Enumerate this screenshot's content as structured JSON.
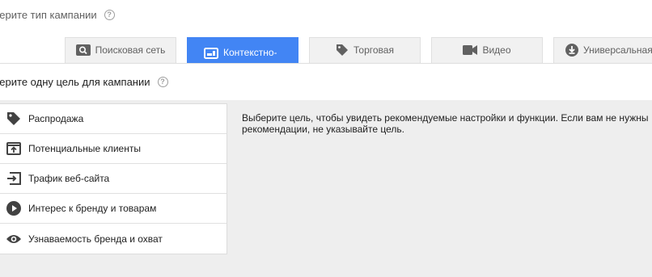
{
  "header": {
    "campaign_type_question": "берите тип кампании"
  },
  "tabs": [
    {
      "label": "Поисковая сеть",
      "icon": "search-icon"
    },
    {
      "label": "Контекстно-медийная",
      "icon": "display-icon"
    },
    {
      "label": "Торговая",
      "icon": "tag-icon"
    },
    {
      "label": "Видео",
      "icon": "video-icon"
    },
    {
      "label": "Универсальная",
      "icon": "download-icon"
    }
  ],
  "goal_section": {
    "question": "берите одну цель для кампании"
  },
  "goals": [
    {
      "label": "Распродажа",
      "icon": "tag-icon"
    },
    {
      "label": "Потенциальные клиенты",
      "icon": "upload-box-icon"
    },
    {
      "label": "Трафик веб-сайта",
      "icon": "enter-arrow-icon"
    },
    {
      "label": "Интерес к бренду и товарам",
      "icon": "play-circle-icon"
    },
    {
      "label": "Узнаваемость бренда и охват",
      "icon": "eye-icon"
    }
  ],
  "description": {
    "line1": "Выберите цель, чтобы увидеть рекомендуемые настройки и функции. Если вам не нужны",
    "line2": "рекомендации, не указывайте цель."
  },
  "colors": {
    "accent": "#4285f4",
    "tab_bg": "#f1f1f1",
    "content_bg": "#eeeeee"
  }
}
